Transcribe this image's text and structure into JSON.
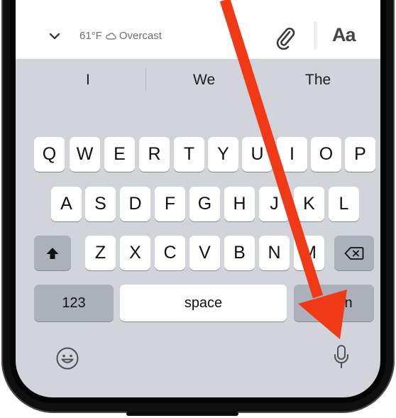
{
  "toolbar": {
    "weather_text": "61°F",
    "weather_condition": "Overcast",
    "format_label": "Aa"
  },
  "suggestions": [
    "I",
    "We",
    "The"
  ],
  "keyboard": {
    "row1": [
      "Q",
      "W",
      "E",
      "R",
      "T",
      "Y",
      "U",
      "I",
      "O",
      "P"
    ],
    "row2": [
      "A",
      "S",
      "D",
      "F",
      "G",
      "H",
      "J",
      "K",
      "L"
    ],
    "row3": [
      "Z",
      "X",
      "C",
      "V",
      "B",
      "N",
      "M"
    ],
    "numbers_label": "123",
    "space_label": "space",
    "return_label": "return"
  },
  "icons": {
    "collapse": "chevron-down-icon",
    "weather": "cloud-icon",
    "attach": "paperclip-icon",
    "shift": "shift-icon",
    "delete": "delete-icon",
    "emoji": "emoji-icon",
    "dictation": "microphone-icon"
  },
  "colors": {
    "arrow": "#f03a17",
    "keyboard_bg": "#d1d4db",
    "key_bg": "#ffffff",
    "dark_key_bg": "#abb0bb"
  }
}
